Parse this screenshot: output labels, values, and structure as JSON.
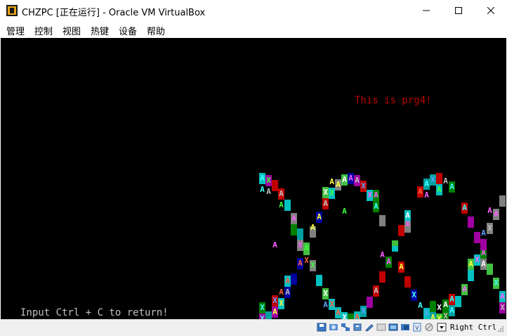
{
  "window": {
    "title": "CHZPC [正在运行] - Oracle VM VirtualBox",
    "minimize_symbol": "—",
    "maximize_symbol": "☐",
    "close_symbol": "✕",
    "icon": "virtualbox-app-icon"
  },
  "menubar": {
    "items": [
      "管理",
      "控制",
      "视图",
      "热键",
      "设备",
      "帮助"
    ]
  },
  "screen": {
    "program_message": "This is prg4!",
    "program_message_color": "#c00000",
    "prompt": "Input Ctrl + C to return!",
    "prompt_color": "#c0c0c0",
    "background": "#000000",
    "pattern_letters": [
      "A",
      "X"
    ]
  },
  "statusbar": {
    "icons": [
      "hard-disk-icon",
      "optical-drive-icon",
      "network-icon",
      "usb-icon",
      "shared-folders-icon",
      "display-icon",
      "video-capture-icon",
      "audio-icon",
      "cpu-icon",
      "mouse-integration-icon",
      "keyboard-icon"
    ],
    "host_key": "Right Ctrl"
  }
}
